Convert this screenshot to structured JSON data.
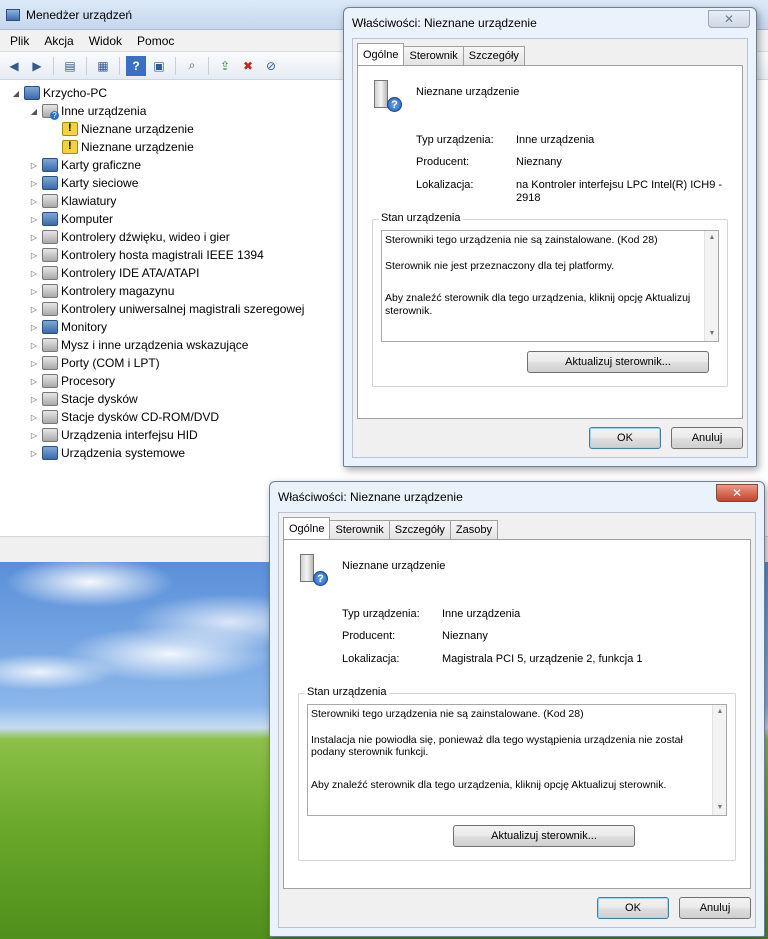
{
  "device_manager": {
    "title": "Menedżer urządzeń",
    "menu": [
      "Plik",
      "Akcja",
      "Widok",
      "Pomoc"
    ],
    "toolbar_icons": [
      "back-icon",
      "forward-icon",
      "properties-icon",
      "view-icon",
      "help-icon",
      "show-hidden-icon",
      "scan-icon",
      "update-driver-icon",
      "uninstall-icon",
      "disable-icon"
    ],
    "tree": [
      {
        "label": "Krzycho-PC",
        "level": 0,
        "expander": "open",
        "icon": "pc"
      },
      {
        "label": "Inne urządzenia",
        "level": 1,
        "expander": "open",
        "icon": "dev-q"
      },
      {
        "label": "Nieznane urządzenie",
        "level": 2,
        "expander": "none",
        "icon": "warn"
      },
      {
        "label": "Nieznane urządzenie",
        "level": 2,
        "expander": "none",
        "icon": "warn"
      },
      {
        "label": "Karty graficzne",
        "level": 1,
        "expander": "closed",
        "icon": "pc"
      },
      {
        "label": "Karty sieciowe",
        "level": 1,
        "expander": "closed",
        "icon": "pc"
      },
      {
        "label": "Klawiatury",
        "level": 1,
        "expander": "closed",
        "icon": "dev"
      },
      {
        "label": "Komputer",
        "level": 1,
        "expander": "closed",
        "icon": "pc"
      },
      {
        "label": "Kontrolery dźwięku, wideo i gier",
        "level": 1,
        "expander": "closed",
        "icon": "dev"
      },
      {
        "label": "Kontrolery hosta magistrali IEEE 1394",
        "level": 1,
        "expander": "closed",
        "icon": "dev"
      },
      {
        "label": "Kontrolery IDE ATA/ATAPI",
        "level": 1,
        "expander": "closed",
        "icon": "dev"
      },
      {
        "label": "Kontrolery magazynu",
        "level": 1,
        "expander": "closed",
        "icon": "dev"
      },
      {
        "label": "Kontrolery uniwersalnej magistrali szeregowej",
        "level": 1,
        "expander": "closed",
        "icon": "dev"
      },
      {
        "label": "Monitory",
        "level": 1,
        "expander": "closed",
        "icon": "pc"
      },
      {
        "label": "Mysz i inne urządzenia wskazujące",
        "level": 1,
        "expander": "closed",
        "icon": "dev"
      },
      {
        "label": "Porty (COM i LPT)",
        "level": 1,
        "expander": "closed",
        "icon": "dev"
      },
      {
        "label": "Procesory",
        "level": 1,
        "expander": "closed",
        "icon": "dev"
      },
      {
        "label": "Stacje dysków",
        "level": 1,
        "expander": "closed",
        "icon": "dev"
      },
      {
        "label": "Stacje dysków CD-ROM/DVD",
        "level": 1,
        "expander": "closed",
        "icon": "dev"
      },
      {
        "label": "Urządzenia interfejsu HID",
        "level": 1,
        "expander": "closed",
        "icon": "dev"
      },
      {
        "label": "Urządzenia systemowe",
        "level": 1,
        "expander": "closed",
        "icon": "pc"
      }
    ]
  },
  "dialog1": {
    "title": "Właściwości: Nieznane urządzenie",
    "tabs": [
      "Ogólne",
      "Sterownik",
      "Szczegóły"
    ],
    "device_name": "Nieznane urządzenie",
    "type_label": "Typ urządzenia:",
    "type_value": "Inne urządzenia",
    "manufacturer_label": "Producent:",
    "manufacturer_value": "Nieznany",
    "location_label": "Lokalizacja:",
    "location_value_line1": "na Kontroler interfejsu LPC Intel(R) ICH9 -",
    "location_value_line2": "2918",
    "status_group": "Stan urządzenia",
    "status_lines": [
      "Sterowniki tego urządzenia nie są zainstalowane. (Kod 28)",
      "Sterownik nie jest przeznaczony dla tej platformy.",
      "Aby znaleźć sterownik dla tego urządzenia, kliknij opcję Aktualizuj sterownik."
    ],
    "update_button": "Aktualizuj sterownik...",
    "ok": "OK",
    "cancel": "Anuluj"
  },
  "dialog2": {
    "title": "Właściwości: Nieznane urządzenie",
    "tabs": [
      "Ogólne",
      "Sterownik",
      "Szczegóły",
      "Zasoby"
    ],
    "device_name": "Nieznane urządzenie",
    "type_label": "Typ urządzenia:",
    "type_value": "Inne urządzenia",
    "manufacturer_label": "Producent:",
    "manufacturer_value": "Nieznany",
    "location_label": "Lokalizacja:",
    "location_value": "Magistrala PCI 5, urządzenie 2, funkcja 1",
    "status_group": "Stan urządzenia",
    "status_lines": [
      "Sterowniki tego urządzenia nie są zainstalowane. (Kod 28)",
      "Instalacja nie powiodła się, ponieważ dla tego wystąpienia urządzenia nie został podany sterownik funkcji.",
      "Aby znaleźć sterownik dla tego urządzenia, kliknij opcję Aktualizuj sterownik."
    ],
    "update_button": "Aktualizuj sterownik...",
    "ok": "OK",
    "cancel": "Anuluj"
  }
}
